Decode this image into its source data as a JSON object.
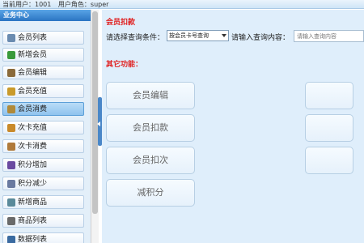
{
  "topbar": {
    "current_user": "当前用户：1001",
    "user_role": "用户角色：super"
  },
  "sidebar": {
    "title": "业务中心",
    "items": [
      {
        "label": "会员列表",
        "icon": "member-list-icon",
        "color": "#6a8bb0"
      },
      {
        "label": "新增会员",
        "icon": "add-member-icon",
        "color": "#3a9a3a"
      },
      {
        "label": "会员编辑",
        "icon": "edit-member-icon",
        "color": "#8a6a3a"
      },
      {
        "label": "会员充值",
        "icon": "recharge-icon",
        "color": "#c99a2a"
      },
      {
        "label": "会员消费",
        "icon": "consume-icon",
        "color": "#b08a3a",
        "active": true
      },
      {
        "label": "次卡充值",
        "icon": "card-recharge-icon",
        "color": "#c98a2a"
      },
      {
        "label": "次卡消费",
        "icon": "card-consume-icon",
        "color": "#b07a3a"
      },
      {
        "label": "积分增加",
        "icon": "points-add-icon",
        "color": "#6a4aa0"
      },
      {
        "label": "积分减少",
        "icon": "points-reduce-icon",
        "color": "#6a7aa0"
      },
      {
        "label": "新增商品",
        "icon": "add-product-icon",
        "color": "#5a8a9a"
      },
      {
        "label": "商品列表",
        "icon": "product-list-icon",
        "color": "#6a6a6a"
      },
      {
        "label": "数据列表",
        "icon": "data-list-icon",
        "color": "#3a6aa0"
      }
    ]
  },
  "main": {
    "section_title": "会员扣款",
    "query_label": "请选择查询条件：",
    "query_select_value": "按会员卡号查询",
    "query_input_label": "请输入查询内容：",
    "query_input_placeholder": "请输入查询内容",
    "other_functions_title": "其它功能：",
    "buttons": [
      "会员编辑",
      "会员扣款",
      "会员扣次",
      "减积分"
    ]
  }
}
